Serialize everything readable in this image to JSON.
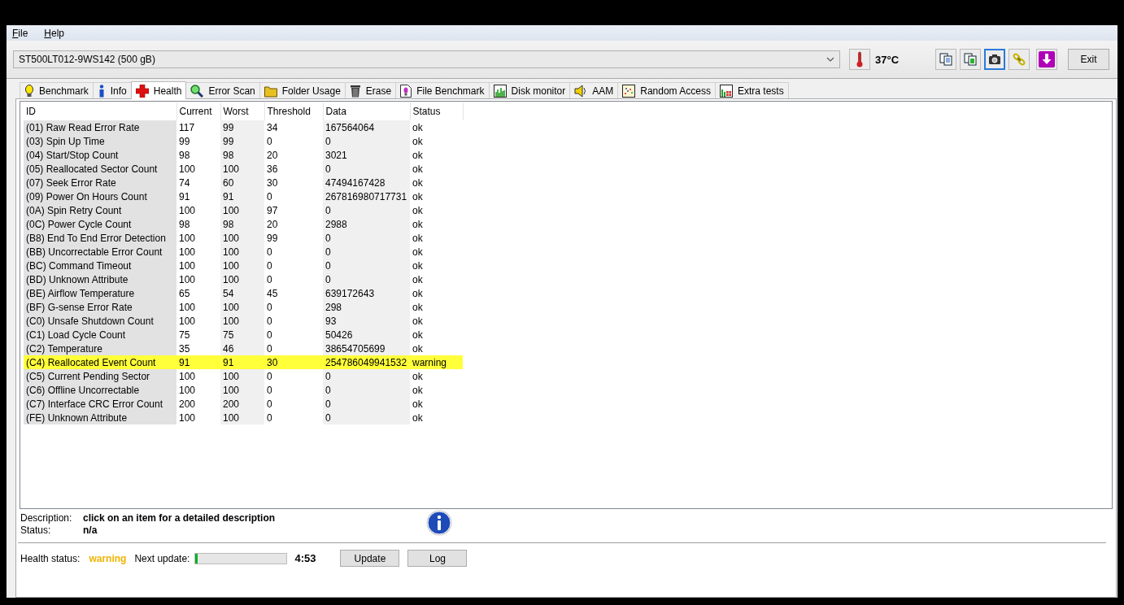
{
  "menu": [
    {
      "label": "File"
    },
    {
      "label": "Help"
    }
  ],
  "toolbar": {
    "drive": "ST500LT012-9WS142 (500 gB)",
    "temperature": "37°C",
    "buttons": [
      {
        "kind": "copy",
        "selected": false
      },
      {
        "kind": "copy-color",
        "selected": false
      },
      {
        "kind": "camera",
        "selected": true
      },
      {
        "kind": "chain",
        "selected": false
      },
      {
        "kind": "download",
        "selected": false
      }
    ],
    "exit": "Exit"
  },
  "tabs": [
    {
      "label": "Benchmark",
      "kind": "bulb",
      "selected": false
    },
    {
      "label": "Info",
      "kind": "info",
      "selected": false
    },
    {
      "label": "Health",
      "kind": "cross",
      "selected": true
    },
    {
      "label": "Error Scan",
      "kind": "magnifier",
      "selected": false
    },
    {
      "label": "Folder Usage",
      "kind": "folder",
      "selected": false
    },
    {
      "label": "Erase",
      "kind": "trash",
      "selected": false
    },
    {
      "label": "File Benchmark",
      "kind": "file",
      "selected": false
    },
    {
      "label": "Disk monitor",
      "kind": "chart",
      "selected": false
    },
    {
      "label": "AAM",
      "kind": "speaker",
      "selected": false
    },
    {
      "label": "Random Access",
      "kind": "scatter",
      "selected": false
    },
    {
      "label": "Extra tests",
      "kind": "grid",
      "selected": false
    }
  ],
  "table": {
    "columns": [
      "ID",
      "Current",
      "Worst",
      "Threshold",
      "Data",
      "Status"
    ],
    "rows": [
      {
        "cells": [
          "(01) Raw Read Error Rate",
          "117",
          "99",
          "34",
          "167564064",
          "ok"
        ],
        "warning": false
      },
      {
        "cells": [
          "(03) Spin Up Time",
          "99",
          "99",
          "0",
          "0",
          "ok"
        ],
        "warning": false
      },
      {
        "cells": [
          "(04) Start/Stop Count",
          "98",
          "98",
          "20",
          "3021",
          "ok"
        ],
        "warning": false
      },
      {
        "cells": [
          "(05) Reallocated Sector Count",
          "100",
          "100",
          "36",
          "0",
          "ok"
        ],
        "warning": false
      },
      {
        "cells": [
          "(07) Seek Error Rate",
          "74",
          "60",
          "30",
          "47494167428",
          "ok"
        ],
        "warning": false
      },
      {
        "cells": [
          "(09) Power On Hours Count",
          "91",
          "91",
          "0",
          "267816980717731",
          "ok"
        ],
        "warning": false
      },
      {
        "cells": [
          "(0A) Spin Retry Count",
          "100",
          "100",
          "97",
          "0",
          "ok"
        ],
        "warning": false
      },
      {
        "cells": [
          "(0C) Power Cycle Count",
          "98",
          "98",
          "20",
          "2988",
          "ok"
        ],
        "warning": false
      },
      {
        "cells": [
          "(B8) End To End Error Detection",
          "100",
          "100",
          "99",
          "0",
          "ok"
        ],
        "warning": false
      },
      {
        "cells": [
          "(BB) Uncorrectable Error Count",
          "100",
          "100",
          "0",
          "0",
          "ok"
        ],
        "warning": false
      },
      {
        "cells": [
          "(BC) Command Timeout",
          "100",
          "100",
          "0",
          "0",
          "ok"
        ],
        "warning": false
      },
      {
        "cells": [
          "(BD) Unknown Attribute",
          "100",
          "100",
          "0",
          "0",
          "ok"
        ],
        "warning": false
      },
      {
        "cells": [
          "(BE) Airflow Temperature",
          "65",
          "54",
          "45",
          "639172643",
          "ok"
        ],
        "warning": false
      },
      {
        "cells": [
          "(BF) G-sense Error Rate",
          "100",
          "100",
          "0",
          "298",
          "ok"
        ],
        "warning": false
      },
      {
        "cells": [
          "(C0) Unsafe Shutdown Count",
          "100",
          "100",
          "0",
          "93",
          "ok"
        ],
        "warning": false
      },
      {
        "cells": [
          "(C1) Load Cycle Count",
          "75",
          "75",
          "0",
          "50426",
          "ok"
        ],
        "warning": false
      },
      {
        "cells": [
          "(C2) Temperature",
          "35",
          "46",
          "0",
          "38654705699",
          "ok"
        ],
        "warning": false
      },
      {
        "cells": [
          "(C4) Reallocated Event Count",
          "91",
          "91",
          "30",
          "254786049941532",
          "warning"
        ],
        "warning": true
      },
      {
        "cells": [
          "(C5) Current Pending Sector",
          "100",
          "100",
          "0",
          "0",
          "ok"
        ],
        "warning": false
      },
      {
        "cells": [
          "(C6) Offline Uncorrectable",
          "100",
          "100",
          "0",
          "0",
          "ok"
        ],
        "warning": false
      },
      {
        "cells": [
          "(C7) Interface CRC Error Count",
          "200",
          "200",
          "0",
          "0",
          "ok"
        ],
        "warning": false
      },
      {
        "cells": [
          "(FE) Unknown Attribute",
          "100",
          "100",
          "0",
          "0",
          "ok"
        ],
        "warning": false
      }
    ]
  },
  "details": {
    "description_label": "Description:",
    "description": "click on an item for a detailed description",
    "status_label": "Status:",
    "status": "n/a"
  },
  "footer": {
    "health_label": "Health status:",
    "health": "warning",
    "next_label": "Next update:",
    "level": 0.02,
    "countdown": "4:53",
    "buttons": [
      "Update",
      "Log"
    ]
  }
}
